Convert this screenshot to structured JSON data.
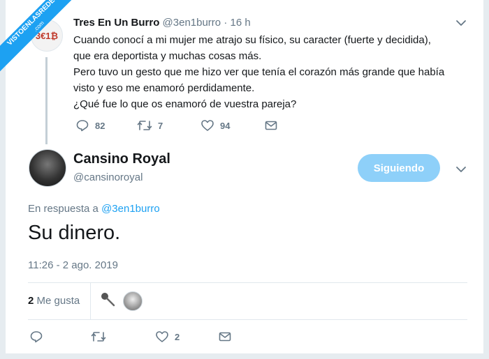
{
  "watermark": {
    "line1": "VISTOENLASREDES",
    "line2": ".com"
  },
  "parent_tweet": {
    "avatar_text": "3€1₿",
    "name": "Tres En Un Burro",
    "handle": "@3en1burro",
    "separator": "·",
    "time": "16 h",
    "text_lines": [
      "Cuando conocí a mi mujer me atrajo su físico, su caracter (fuerte y decidida),",
      "que era deportista y muchas cosas más.",
      "Pero tuvo un gesto que me hizo ver que tenía el corazón más grande que había",
      "visto y eso me enamoró perdidamente.",
      "¿Qué fue lo que os enamoró de vuestra pareja?"
    ],
    "replies": "82",
    "retweets": "7",
    "likes": "94"
  },
  "main_tweet": {
    "name": "Cansino Royal",
    "handle": "@cansinoroyal",
    "follow_label": "Siguiendo",
    "reply_prefix": "En respuesta a",
    "reply_to": "@3en1burro",
    "text": "Su dinero.",
    "date": "11:26 - 2 ago. 2019",
    "like_count": "2",
    "like_label": "Me gusta",
    "action_like_count": "2"
  },
  "colors": {
    "accent": "#1da1f2",
    "follow_button": "#8ed0f9",
    "muted": "#657786"
  }
}
